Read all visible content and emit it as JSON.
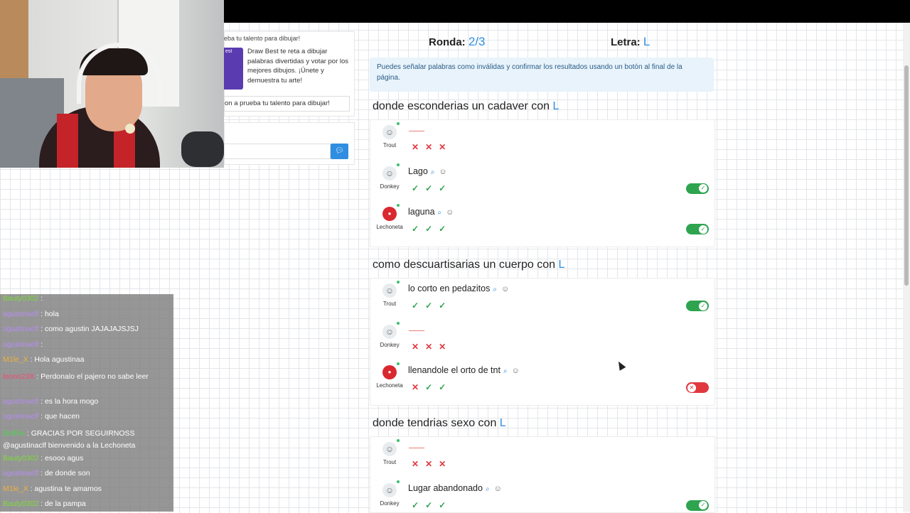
{
  "promo": {
    "title": "eba tu talento para dibujar!",
    "image_label": "est",
    "text": "Draw Best te reta a dibujar palabras divertidas y votar por los mejores dibujos. ¡Únete y demuestra tu arte!",
    "button": "on a prueba tu talento para dibujar!"
  },
  "chat_log": [
    {
      "user": "Bauty0302",
      "msg": ":",
      "user_color": "#7ddc3a"
    },
    {
      "user": "agustinaclf",
      "msg": ": hola",
      "user_color": "#b58cf2"
    },
    {
      "user": "agustinaclf",
      "msg": ": como agustin JAJAJAJSJSJ",
      "user_color": "#b58cf2"
    },
    {
      "user": "agustinaclf",
      "msg": ":",
      "user_color": "#b58cf2"
    },
    {
      "user": "M1le_X",
      "msg": ": Hola agustinaa",
      "user_color": "#f0b23a"
    },
    {
      "user": "leonn23X",
      "msg": ": Perdonalo el pajero no sabe leer",
      "user_color": "#f24a6e"
    },
    {
      "user": "agustinaclf",
      "msg": ": es la hora mogo",
      "user_color": "#b58cf2"
    },
    {
      "user": "agustinaclf",
      "msg": ": que hacen",
      "user_color": "#b58cf2"
    },
    {
      "user": "BotRix",
      "msg": ": GRACIAS POR SEGUIRNOSS @agustinaclf bienvenido a la Lechoneta",
      "user_color": "#4fd14f"
    },
    {
      "user": "Bauty0302",
      "msg": ": esooo agus",
      "user_color": "#7ddc3a"
    },
    {
      "user": "agustinaclf",
      "msg": ": de donde son",
      "user_color": "#b58cf2"
    },
    {
      "user": "M1le_X",
      "msg": ": agustina te amamos",
      "user_color": "#f0b23a"
    },
    {
      "user": "Bauty0302",
      "msg": ": de la pampa",
      "user_color": "#7ddc3a"
    }
  ],
  "game": {
    "round_label": "Ronda:",
    "round_value": "2/3",
    "letter_label": "Letra:",
    "letter_value": "L",
    "info": "Puedes señalar palabras como inválidas y confirmar los resultados usando un botón al final de la página."
  },
  "questions": [
    {
      "prefix": "donde esconderias un cadaver con",
      "letter": "L",
      "answers": [
        {
          "player": "Trout",
          "text": "",
          "votes": [
            "x",
            "x",
            "x"
          ],
          "toggle": null
        },
        {
          "player": "Donkey",
          "text": "Lago",
          "votes": [
            "ok",
            "ok",
            "ok"
          ],
          "toggle": "on"
        },
        {
          "player": "Lechoneta",
          "text": "laguna",
          "votes": [
            "ok",
            "ok",
            "ok"
          ],
          "toggle": "on"
        }
      ]
    },
    {
      "prefix": "como descuartisarias un cuerpo con",
      "letter": "L",
      "answers": [
        {
          "player": "Trout",
          "text": "lo corto en pedazitos",
          "votes": [
            "ok",
            "ok",
            "ok"
          ],
          "toggle": "on"
        },
        {
          "player": "Donkey",
          "text": "",
          "votes": [
            "x",
            "x",
            "x"
          ],
          "toggle": null
        },
        {
          "player": "Lechoneta",
          "text": "llenandole el orto de tnt",
          "votes": [
            "x",
            "ok",
            "ok"
          ],
          "toggle": "off"
        }
      ]
    },
    {
      "prefix": "donde tendrias sexo con",
      "letter": "L",
      "answers": [
        {
          "player": "Trout",
          "text": "",
          "votes": [
            "x",
            "x",
            "x"
          ],
          "toggle": null
        },
        {
          "player": "Donkey",
          "text": "Lugar abandonado",
          "votes": [
            "ok",
            "ok",
            "ok"
          ],
          "toggle": "on"
        }
      ]
    }
  ],
  "icons": {
    "user": "user-icon",
    "search": "search-icon",
    "emoji": "smile-icon",
    "send": "send-icon",
    "check": "check-icon",
    "cross": "x-icon"
  },
  "colors": {
    "accent": "#2f8ee0",
    "ok": "#2ea44f",
    "bad": "#e0383e"
  }
}
